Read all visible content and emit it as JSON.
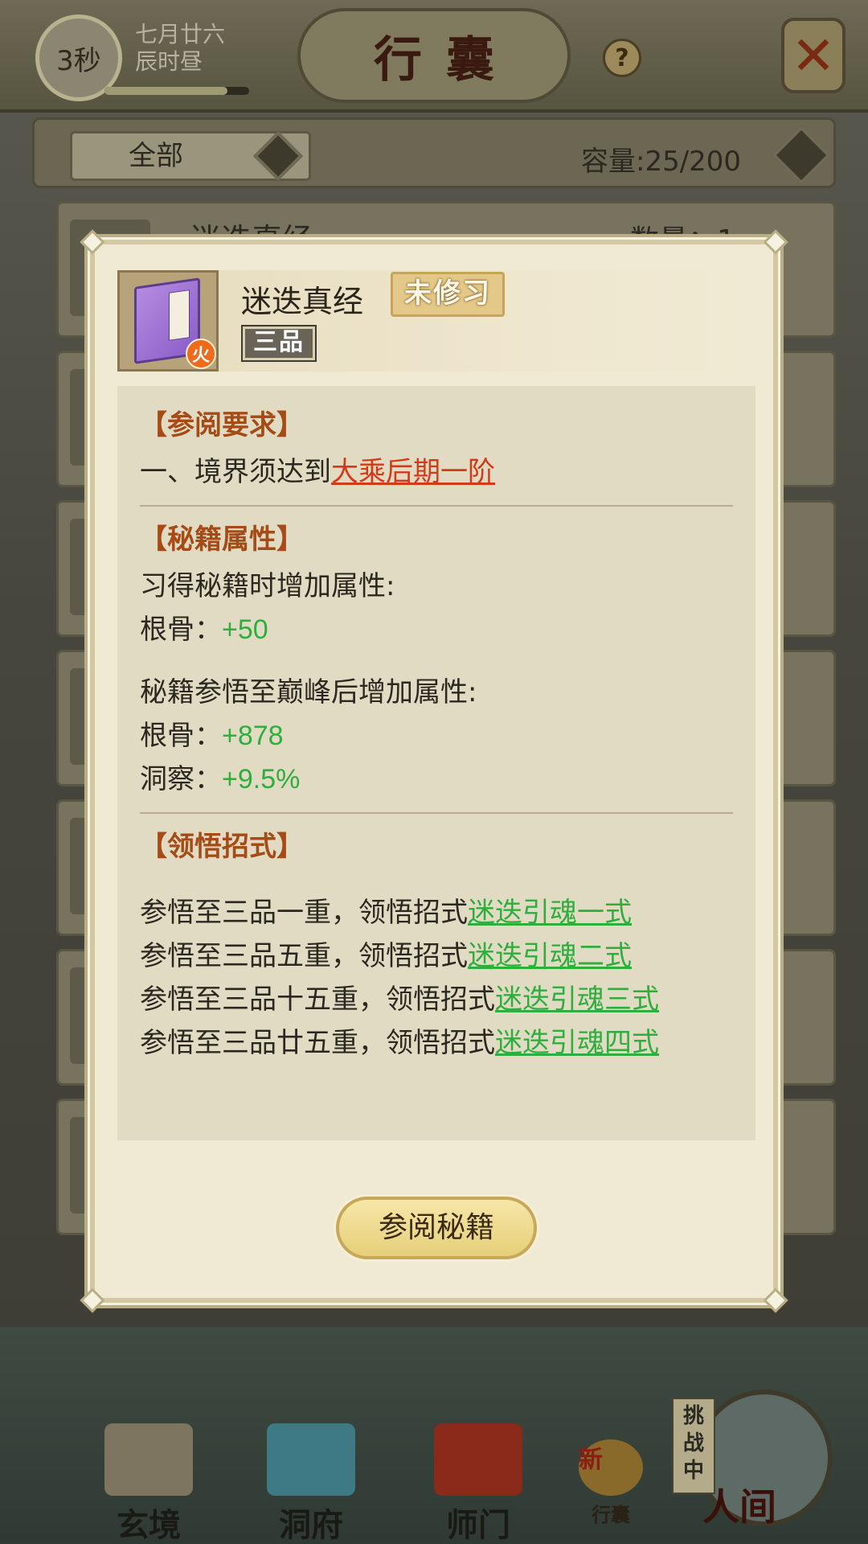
{
  "header": {
    "timer": "3秒",
    "date_line1": "七月廿六",
    "date_line2": "辰时昼",
    "time_progress": 0.85,
    "title": "行囊",
    "help": "?"
  },
  "filter": {
    "selected": "全部",
    "capacity": "容量:25/200"
  },
  "background_item": {
    "name": "迷迭真经",
    "count": "数量：1"
  },
  "modal": {
    "book_name": "迷迭真经",
    "status": "未修习",
    "grade": "三品",
    "element_badge": "火",
    "requirements": {
      "title": "【参阅要求】",
      "prefix": "一、境界须达到",
      "realm": "大乘后期一阶"
    },
    "attributes": {
      "title": "【秘籍属性】",
      "learn_label": "习得秘籍时增加属性:",
      "learn": [
        {
          "name": "根骨：",
          "value": "+50"
        }
      ],
      "peak_label": "秘籍参悟至巅峰后增加属性:",
      "peak": [
        {
          "name": "根骨：",
          "value": "+878"
        },
        {
          "name": "洞察：",
          "value": "+9.5%"
        }
      ]
    },
    "moves": {
      "title": "【领悟招式】",
      "items": [
        {
          "prefix": "参悟至三品一重，领悟招式",
          "move": "迷迭引魂一式"
        },
        {
          "prefix": "参悟至三品五重，领悟招式",
          "move": "迷迭引魂二式"
        },
        {
          "prefix": "参悟至三品十五重，领悟招式",
          "move": "迷迭引魂三式"
        },
        {
          "prefix": "参悟至三品廿五重，领悟招式",
          "move": "迷迭引魂四式"
        }
      ]
    },
    "read_button": "参阅秘籍"
  },
  "bottom_nav": {
    "items": [
      "玄境",
      "洞府",
      "师门",
      "行囊"
    ],
    "new_badge": "新",
    "challenge_tag": "挑战中",
    "renjian": "人间"
  },
  "colors": {
    "accent_title": "#a64a16",
    "link_red": "#d43a18",
    "value_green": "#2fae3e"
  }
}
